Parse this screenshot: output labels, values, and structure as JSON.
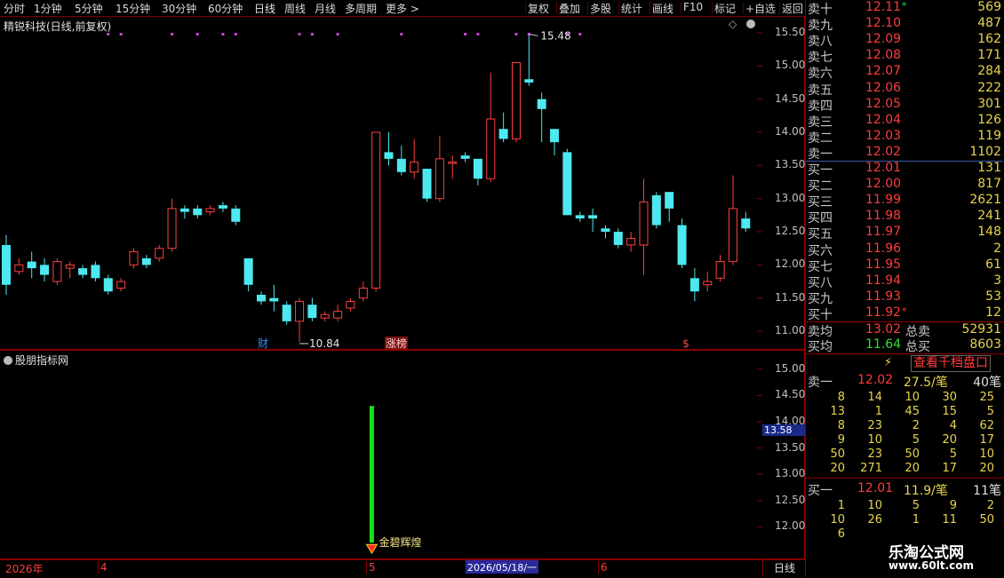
{
  "toolbar": {
    "periods": [
      "分时",
      "1分钟",
      "5分钟",
      "15分钟",
      "30分钟",
      "60分钟",
      "日线",
      "周线",
      "月线",
      "多周期",
      "更多 >"
    ],
    "active": "日线",
    "actions": [
      "复权",
      "叠加",
      "多股",
      "统计",
      "画线",
      "F10",
      "标记",
      "+自选",
      "返回"
    ]
  },
  "main_chart": {
    "title": "精锐科技(日线,前复权)",
    "price_ticks": [
      "15.50",
      "15.00",
      "14.50",
      "14.00",
      "13.50",
      "13.00",
      "12.50",
      "12.00",
      "11.50",
      "11.00"
    ],
    "high_label": "15.48",
    "low_label": "10.84",
    "markers": [
      "财",
      "涨榜",
      "$"
    ],
    "colors": {
      "up": "#ff4040",
      "down": "#4de8f0",
      "bg": "#000000",
      "frame": "#8a0000"
    }
  },
  "chart_data": {
    "type": "candlestick",
    "ylim": [
      10.8,
      15.7
    ],
    "candles": [
      [
        12.3,
        11.7,
        12.45,
        11.55
      ],
      [
        11.9,
        12.0,
        12.1,
        11.85
      ],
      [
        12.05,
        11.95,
        12.2,
        11.8
      ],
      [
        12.0,
        11.85,
        12.1,
        11.75
      ],
      [
        11.75,
        12.05,
        12.1,
        11.7
      ],
      [
        11.95,
        12.0,
        12.05,
        11.8
      ],
      [
        11.95,
        11.85,
        12.0,
        11.8
      ],
      [
        12.0,
        11.8,
        12.05,
        11.75
      ],
      [
        11.8,
        11.6,
        11.85,
        11.55
      ],
      [
        11.65,
        11.75,
        11.8,
        11.6
      ],
      [
        12.0,
        12.2,
        12.25,
        11.95
      ],
      [
        12.1,
        12.0,
        12.15,
        11.95
      ],
      [
        12.1,
        12.25,
        12.3,
        12.05
      ],
      [
        12.25,
        12.85,
        13.0,
        12.2
      ],
      [
        12.85,
        12.8,
        12.9,
        12.7
      ],
      [
        12.85,
        12.75,
        12.9,
        12.7
      ],
      [
        12.8,
        12.85,
        12.9,
        12.75
      ],
      [
        12.9,
        12.85,
        12.95,
        12.8
      ],
      [
        12.85,
        12.65,
        12.9,
        12.6
      ],
      [
        12.1,
        11.7,
        12.1,
        11.6
      ],
      [
        11.55,
        11.45,
        11.6,
        11.4
      ],
      [
        11.5,
        11.45,
        11.7,
        11.3
      ],
      [
        11.4,
        11.15,
        11.45,
        11.1
      ],
      [
        11.15,
        11.45,
        11.5,
        10.84
      ],
      [
        11.4,
        11.2,
        11.5,
        11.15
      ],
      [
        11.2,
        11.25,
        11.3,
        11.15
      ],
      [
        11.2,
        11.3,
        11.4,
        11.15
      ],
      [
        11.35,
        11.45,
        11.5,
        11.3
      ],
      [
        11.5,
        11.65,
        11.75,
        11.45
      ],
      [
        11.65,
        14.0,
        14.0,
        11.6
      ],
      [
        13.7,
        13.6,
        14.0,
        13.5
      ],
      [
        13.6,
        13.4,
        13.8,
        13.35
      ],
      [
        13.4,
        13.55,
        13.9,
        13.3
      ],
      [
        13.45,
        13.0,
        13.45,
        12.95
      ],
      [
        13.0,
        13.6,
        13.95,
        12.95
      ],
      [
        13.55,
        13.55,
        13.65,
        13.3
      ],
      [
        13.65,
        13.6,
        13.7,
        13.55
      ],
      [
        13.6,
        13.3,
        13.6,
        13.2
      ],
      [
        13.3,
        14.2,
        14.9,
        13.25
      ],
      [
        14.05,
        13.9,
        14.3,
        13.85
      ],
      [
        13.9,
        15.05,
        15.05,
        13.85
      ],
      [
        14.8,
        14.75,
        15.48,
        14.7
      ],
      [
        14.5,
        14.35,
        14.6,
        13.85
      ],
      [
        14.05,
        13.85,
        14.05,
        13.65
      ],
      [
        13.7,
        12.75,
        13.75,
        12.75
      ],
      [
        12.75,
        12.7,
        12.8,
        12.65
      ],
      [
        12.75,
        12.7,
        12.85,
        12.5
      ],
      [
        12.55,
        12.5,
        12.6,
        12.4
      ],
      [
        12.5,
        12.3,
        12.55,
        12.25
      ],
      [
        12.3,
        12.4,
        12.5,
        12.2
      ],
      [
        12.3,
        12.95,
        13.3,
        11.85
      ],
      [
        13.05,
        12.6,
        13.1,
        12.55
      ],
      [
        13.1,
        12.85,
        13.1,
        12.65
      ],
      [
        12.6,
        12.0,
        12.7,
        11.95
      ],
      [
        11.8,
        11.6,
        11.95,
        11.45
      ],
      [
        11.7,
        11.75,
        11.9,
        11.6
      ],
      [
        11.8,
        12.05,
        12.15,
        11.75
      ],
      [
        12.05,
        12.85,
        13.35,
        12.0
      ],
      [
        12.7,
        12.55,
        12.8,
        12.5
      ]
    ],
    "top_dots": [
      8,
      9,
      13,
      15,
      17,
      18,
      23,
      24,
      26,
      31,
      36,
      37,
      40,
      41,
      44,
      45
    ],
    "indicator": {
      "bar_index": 27,
      "top": 14.3,
      "bottom": 11.7,
      "label": "金碧辉煌"
    }
  },
  "indicator_panel": {
    "title": "股朋指标网",
    "ticks": [
      "15.00",
      "14.50",
      "14.00",
      "13.50",
      "13.00",
      "12.50",
      "12.00"
    ],
    "cursor_value": "13.58",
    "signal_label": "金碧辉煌"
  },
  "date_axis": {
    "labels": [
      "2026年",
      "4",
      "5",
      "6"
    ],
    "cursor": "2026/05/18/一",
    "period": "日线"
  },
  "orderbook": {
    "asks": [
      {
        "name": "卖十",
        "price": "12.11",
        "vol": "569",
        "flag": "*"
      },
      {
        "name": "卖九",
        "price": "12.10",
        "vol": "487"
      },
      {
        "name": "卖八",
        "price": "12.09",
        "vol": "162"
      },
      {
        "name": "卖七",
        "price": "12.08",
        "vol": "171"
      },
      {
        "name": "卖六",
        "price": "12.07",
        "vol": "284"
      },
      {
        "name": "卖五",
        "price": "12.06",
        "vol": "222"
      },
      {
        "name": "卖四",
        "price": "12.05",
        "vol": "301"
      },
      {
        "name": "卖三",
        "price": "12.04",
        "vol": "126"
      },
      {
        "name": "卖二",
        "price": "12.03",
        "vol": "119"
      },
      {
        "name": "卖一",
        "price": "12.02",
        "vol": "1102"
      }
    ],
    "bids": [
      {
        "name": "买一",
        "price": "12.01",
        "vol": "131"
      },
      {
        "name": "买二",
        "price": "12.00",
        "vol": "817"
      },
      {
        "name": "买三",
        "price": "11.99",
        "vol": "2621"
      },
      {
        "name": "买四",
        "price": "11.98",
        "vol": "241"
      },
      {
        "name": "买五",
        "price": "11.97",
        "vol": "148"
      },
      {
        "name": "买六",
        "price": "11.96",
        "vol": "2"
      },
      {
        "name": "买七",
        "price": "11.95",
        "vol": "61"
      },
      {
        "name": "买八",
        "price": "11.94",
        "vol": "3"
      },
      {
        "name": "买九",
        "price": "11.93",
        "vol": "53"
      },
      {
        "name": "买十",
        "price": "11.92",
        "vol": "12",
        "flag": "*"
      }
    ],
    "avg_sell": {
      "name": "卖均",
      "price": "13.02",
      "tname": "总卖",
      "vol": "52931"
    },
    "avg_buy": {
      "name": "买均",
      "price": "11.64",
      "tname": "总买",
      "vol": "8603"
    }
  },
  "qiandang": {
    "button": "查看千档盘口",
    "sell1": {
      "name": "卖一",
      "price": "12.02",
      "per": "27.5/笔",
      "count": "40笔"
    },
    "sell_queue": [
      [
        "8",
        "14",
        "10",
        "30",
        "25"
      ],
      [
        "13",
        "1",
        "45",
        "15",
        "5"
      ],
      [
        "8",
        "23",
        "2",
        "4",
        "62"
      ],
      [
        "9",
        "10",
        "5",
        "20",
        "17"
      ],
      [
        "50",
        "23",
        "50",
        "5",
        "10"
      ],
      [
        "20",
        "271",
        "20",
        "17",
        "20"
      ]
    ],
    "buy1": {
      "name": "买一",
      "price": "12.01",
      "per": "11.9/笔",
      "count": "11笔"
    },
    "buy_queue": [
      [
        "1",
        "10",
        "5",
        "9",
        "2"
      ],
      [
        "10",
        "26",
        "1",
        "11",
        "50"
      ],
      [
        "6",
        "",
        "",
        "",
        ""
      ]
    ]
  },
  "watermark": {
    "title": "乐淘公式网",
    "url": "www.60lt.com"
  }
}
